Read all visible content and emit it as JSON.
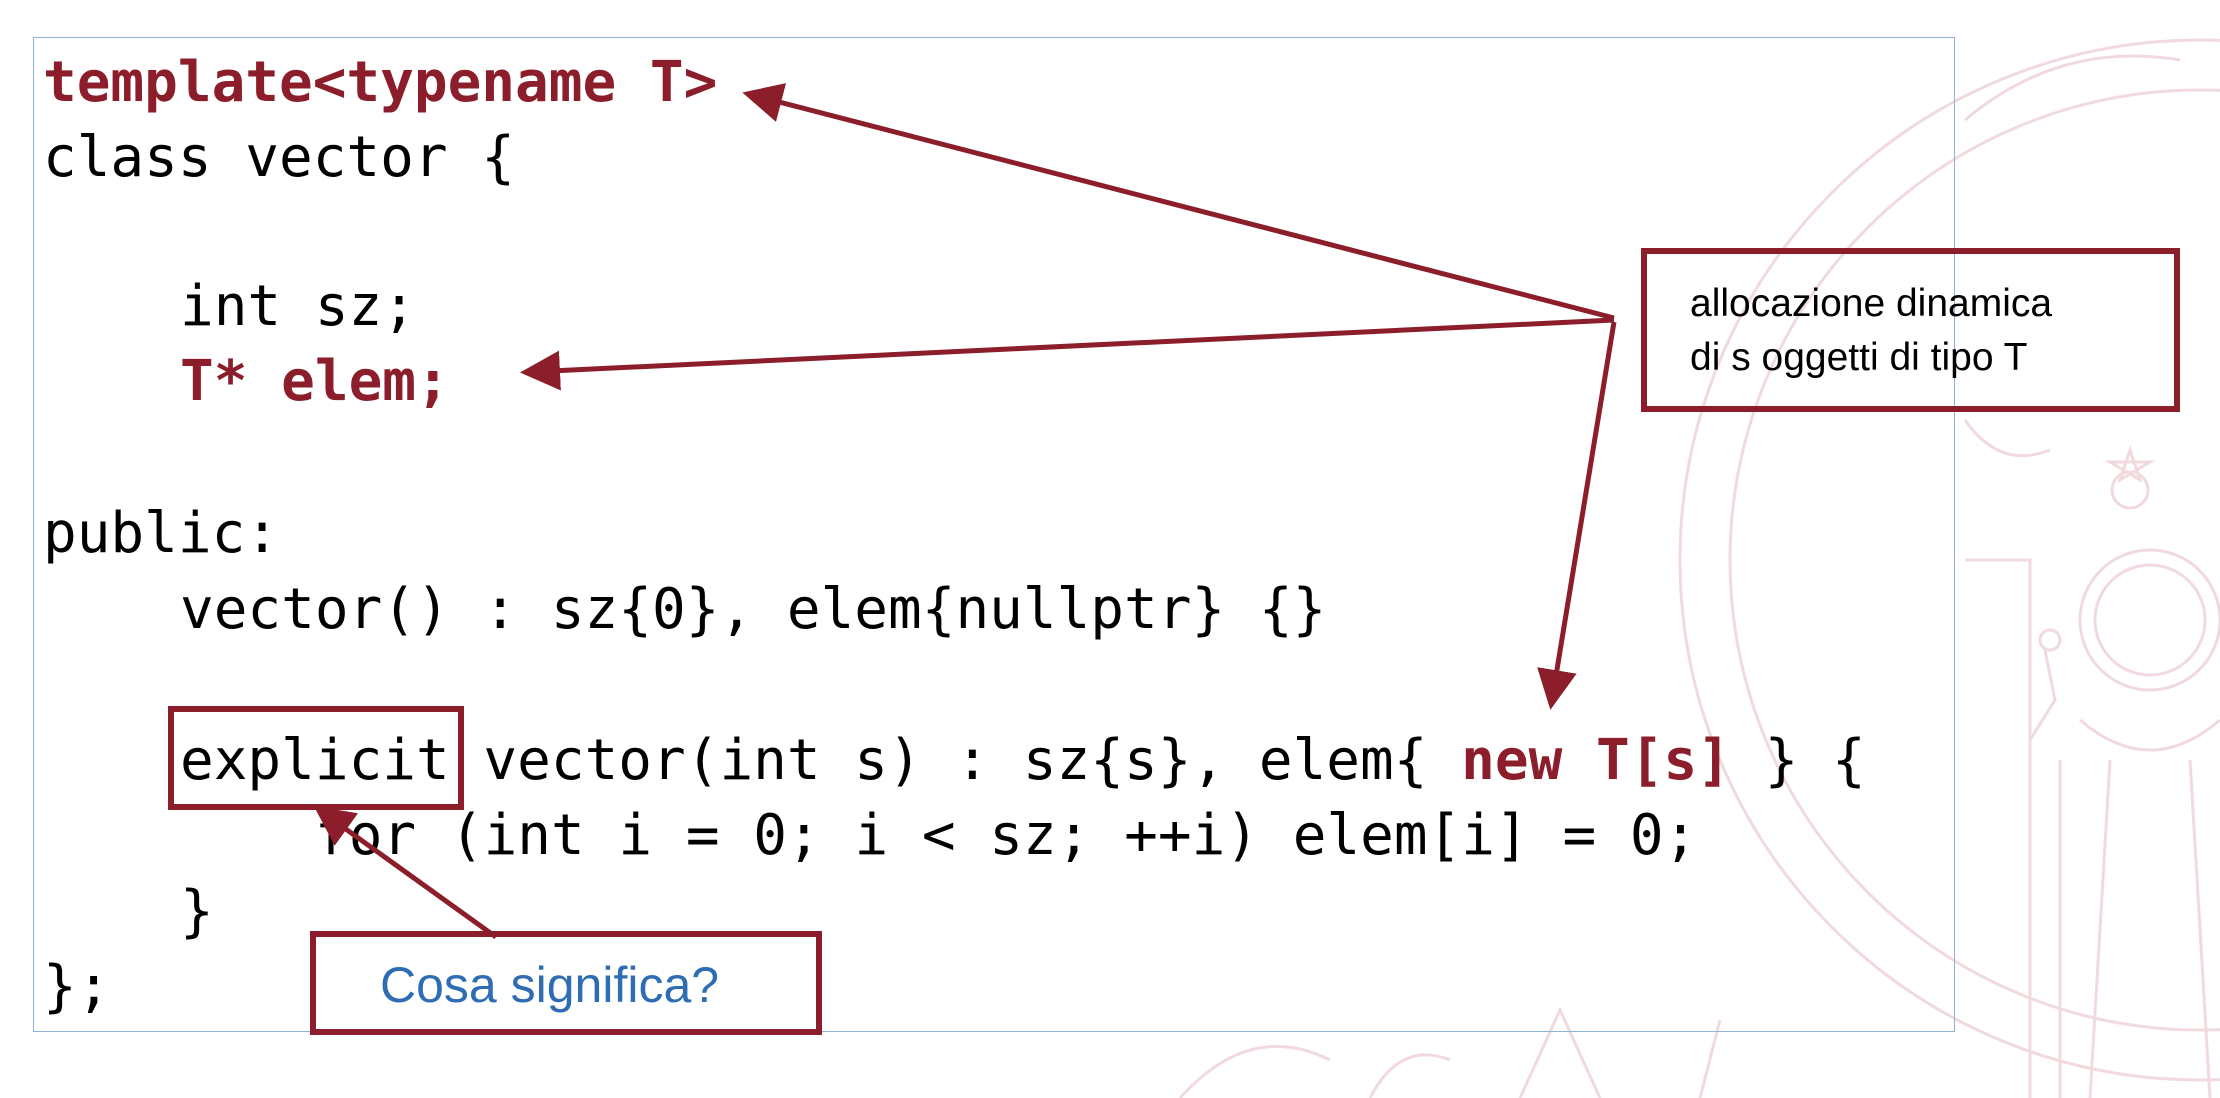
{
  "code": {
    "line1": "template<typename T>",
    "line2": "class vector {",
    "line3": "int sz;",
    "line4": "T* elem;",
    "line5": "public:",
    "line6": "vector() : sz{0}, elem{nullptr} {}",
    "line7_explicit": "explicit",
    "line7_mid": " vector(int s) : sz{s}, elem{ ",
    "line7_new": "new T[s]",
    "line7_end": " } {",
    "line8": "for (int i = 0; i < sz; ++i) elem[i] = 0;",
    "line9": "}",
    "line10": "};"
  },
  "callouts": {
    "allocation_line1": "allocazione dinamica",
    "allocation_line2": "di s oggetti di tipo T",
    "question": "Cosa significa?"
  },
  "colors": {
    "accent": "#8b1e2a",
    "question": "#2e6db4",
    "code_box_border": "#8fb3d9"
  }
}
